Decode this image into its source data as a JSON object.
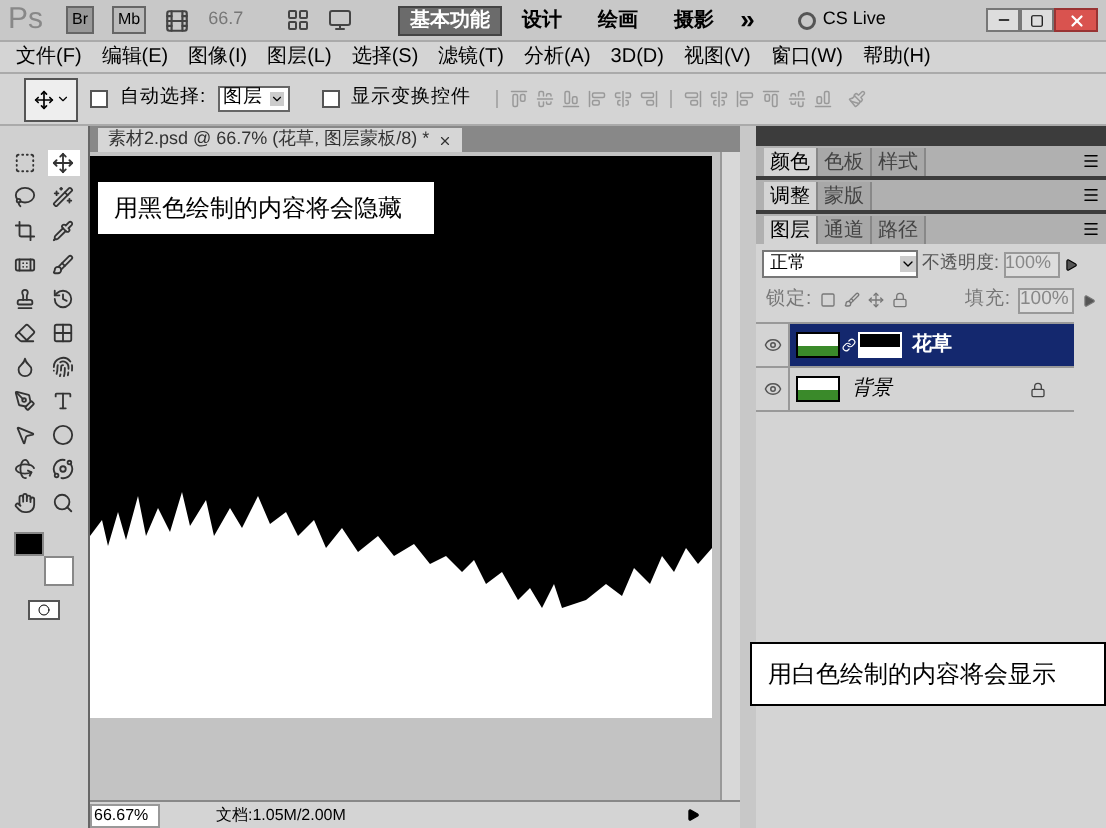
{
  "app_bar": {
    "logo": "Ps",
    "bridge": "Br",
    "mini_bridge": "Mb",
    "zoom": "66.7",
    "workspaces": [
      {
        "label": "基本功能",
        "selected": true
      },
      {
        "label": "设计",
        "selected": false
      },
      {
        "label": "绘画",
        "selected": false
      },
      {
        "label": "摄影",
        "selected": false
      }
    ],
    "more": "»",
    "cs_live": "CS Live"
  },
  "menu": [
    "文件(F)",
    "编辑(E)",
    "图像(I)",
    "图层(L)",
    "选择(S)",
    "滤镜(T)",
    "分析(A)",
    "3D(D)",
    "视图(V)",
    "窗口(W)",
    "帮助(H)"
  ],
  "options_bar": {
    "auto_select": {
      "label": "自动选择:",
      "checked": false
    },
    "select_value": "图层",
    "show_transform": {
      "label": "显示变换控件",
      "checked": false
    }
  },
  "document": {
    "tab": "素材2.psd @ 66.7% (花草, 图层蒙板/8) *",
    "callout_top": "用黑色绘制的内容将会隐藏",
    "callout_bottom": "用白色绘制的内容将会显示"
  },
  "status_bar": {
    "zoom": "66.67%",
    "doc_size": "文档:1.05M/2.00M"
  },
  "panel_groups": [
    {
      "tabs": [
        {
          "label": "颜色",
          "selected": true
        },
        {
          "label": "色板",
          "selected": false
        },
        {
          "label": "样式",
          "selected": false
        }
      ]
    },
    {
      "tabs": [
        {
          "label": "调整",
          "selected": true
        },
        {
          "label": "蒙版",
          "selected": false
        }
      ]
    },
    {
      "tabs": [
        {
          "label": "图层",
          "selected": true
        },
        {
          "label": "通道",
          "selected": false
        },
        {
          "label": "路径",
          "selected": false
        }
      ]
    }
  ],
  "layers_panel": {
    "blend_mode": "正常",
    "opacity_label": "不透明度:",
    "opacity": "100%",
    "lock_label": "锁定:",
    "fill_label": "填充:",
    "fill": "100%",
    "layers": [
      {
        "name": "花草",
        "selected": true,
        "has_mask": true,
        "locked": false
      },
      {
        "name": "背景",
        "selected": false,
        "has_mask": false,
        "locked": true
      }
    ]
  }
}
